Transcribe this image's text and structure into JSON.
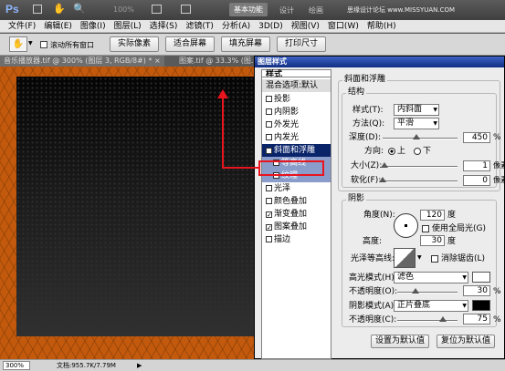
{
  "app": {
    "logo": "Ps",
    "workspace_btn": "基本功能",
    "design_btn": "设计",
    "draw_btn": "绘画",
    "watermark": "思缘设计论坛 www.MISSYUAN.COM",
    "zoom_menu": "100%"
  },
  "menu": [
    "文件(F)",
    "编辑(E)",
    "图像(I)",
    "图层(L)",
    "选择(S)",
    "滤镜(T)",
    "分析(A)",
    "3D(D)",
    "视图(V)",
    "窗口(W)",
    "帮助(H)"
  ],
  "options": {
    "scroll_all": "滚动所有窗口",
    "actual_pixels": "实际像素",
    "fit_screen": "适合屏幕",
    "fill_screen": "填充屏幕",
    "print_size": "打印尺寸"
  },
  "tabs": [
    "音乐播放器.tif @ 300% (图层 3, RGB/8#) * ×",
    "图案.tif @ 33.3% (图..."
  ],
  "status": {
    "zoom": "300%",
    "doc": "文档:955.7K/7.79M"
  },
  "dialog": {
    "title": "图层样式",
    "style_header": "样式",
    "blend_options": "混合选项:默认",
    "styles": [
      {
        "label": "投影",
        "checked": false
      },
      {
        "label": "内阴影",
        "checked": false
      },
      {
        "label": "外发光",
        "checked": false
      },
      {
        "label": "内发光",
        "checked": false
      },
      {
        "label": "斜面和浮雕",
        "checked": true,
        "selected": true
      },
      {
        "label": "等高线",
        "checked": false,
        "sub": true
      },
      {
        "label": "纹理",
        "checked": false,
        "sub": true
      },
      {
        "label": "光泽",
        "checked": false
      },
      {
        "label": "颜色叠加",
        "checked": false
      },
      {
        "label": "渐变叠加",
        "checked": true
      },
      {
        "label": "图案叠加",
        "checked": true
      },
      {
        "label": "描边",
        "checked": false
      }
    ],
    "bevel_title": "斜面和浮雕",
    "structure": "结构",
    "style_label": "样式(T):",
    "style_value": "内斜面",
    "technique_label": "方法(Q):",
    "technique_value": "平滑",
    "depth_label": "深度(D):",
    "depth_value": "450",
    "depth_unit": "%",
    "depth_pct": 45,
    "direction_label": "方向:",
    "direction_up": "上",
    "direction_down": "下",
    "size_label": "大小(Z):",
    "size_value": "1",
    "size_unit": "像素",
    "size_pct": 2,
    "soften_label": "软化(F):",
    "soften_value": "0",
    "soften_unit": "像素",
    "soften_pct": 0,
    "shading": "阴影",
    "angle_label": "角度(N):",
    "angle_value": "120",
    "angle_unit": "度",
    "global_light": "使用全局光(G)",
    "altitude_label": "高度:",
    "altitude_value": "30",
    "altitude_unit": "度",
    "gloss_label": "光泽等高线:",
    "anti_alias": "消除锯齿(L)",
    "highlight_label": "高光模式(H):",
    "highlight_value": "滤色",
    "highlight_color": "#ffffff",
    "hl_opacity_label": "不透明度(O):",
    "hl_opacity_value": "30",
    "hl_opacity_pct": 30,
    "shadow_label": "阴影模式(A):",
    "shadow_value": "正片叠底",
    "shadow_color": "#000000",
    "sh_opacity_label": "不透明度(C):",
    "sh_opacity_value": "75",
    "sh_opacity_pct": 75,
    "pct": "%",
    "make_default": "设置为默认值",
    "reset_default": "复位为默认值"
  },
  "colors": {
    "highlight_box": "#e8141e"
  }
}
